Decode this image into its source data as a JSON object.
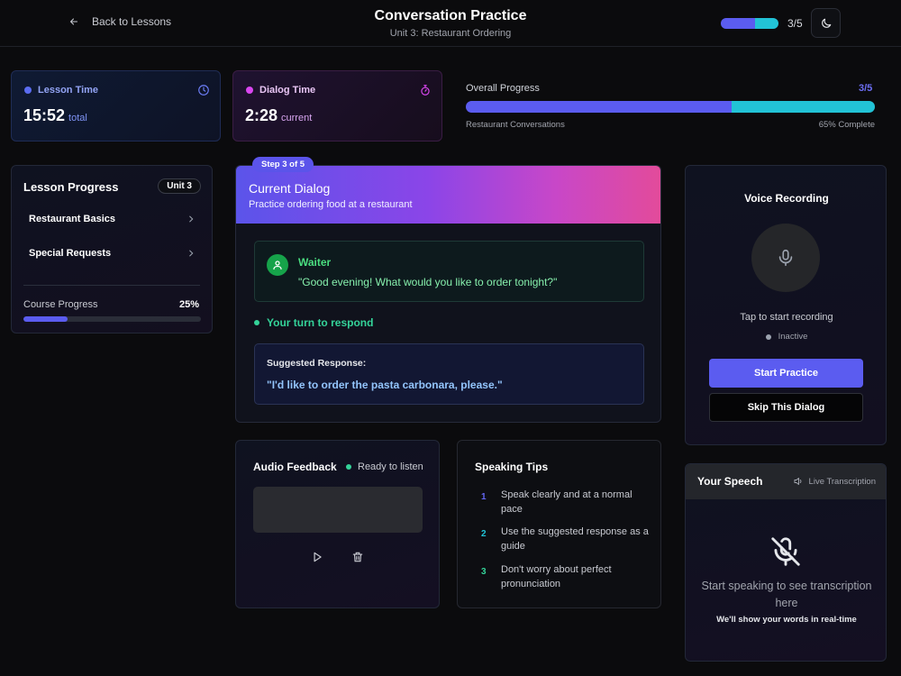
{
  "header": {
    "back_label": "Back to Lessons",
    "title": "Conversation Practice",
    "subtitle": "Unit 3: Restaurant Ordering",
    "progress_count": "3/5",
    "progress_fraction": 0.6
  },
  "stats": {
    "lesson_time": {
      "label": "Lesson Time",
      "value": "15:52",
      "unit": "total",
      "color": "#5b6cf0"
    },
    "dialog_time": {
      "label": "Dialog Time",
      "value": "2:28",
      "unit": "current",
      "color": "#d946ef"
    }
  },
  "overall": {
    "label": "Overall Progress",
    "count": "3/5",
    "left_caption": "Restaurant Conversations",
    "right_caption": "65% Complete",
    "fraction": 0.65
  },
  "lesson_progress": {
    "title": "Lesson Progress",
    "badge": "Unit 3",
    "items": [
      {
        "label": "Restaurant Basics"
      },
      {
        "label": "Special Requests"
      }
    ],
    "course_label": "Course Progress",
    "course_value": "25%",
    "course_fraction": 0.25
  },
  "dialog": {
    "step_badge": "Step 3 of 5",
    "title": "Current Dialog",
    "subtitle": "Practice ordering food at a restaurant",
    "speaker": "Waiter",
    "line": "\"Good evening! What would you like to order tonight?\"",
    "turn_label": "Your turn to respond",
    "suggested_label": "Suggested Response:",
    "suggested_text": "\"I'd like to order the pasta carbonara, please.\""
  },
  "audio_feedback": {
    "title": "Audio Feedback",
    "status": "Ready to listen"
  },
  "tips": {
    "title": "Speaking Tips",
    "items": [
      {
        "num": "1",
        "text": "Speak clearly and at a normal pace",
        "color": "#6366f1"
      },
      {
        "num": "2",
        "text": "Use the suggested response as a guide",
        "color": "#22c3d6"
      },
      {
        "num": "3",
        "text": "Don't worry about perfect pronunciation",
        "color": "#34d399"
      }
    ]
  },
  "voice": {
    "title": "Voice Recording",
    "tap_label": "Tap to start recording",
    "state": "Inactive",
    "start_label": "Start Practice",
    "skip_label": "Skip This Dialog"
  },
  "speech": {
    "title": "Your Speech",
    "live_label": "Live Transcription",
    "hint": "Start speaking to see transcription here",
    "hint_sub": "We'll show your words in real-time"
  },
  "colors": {
    "accent": "#5b5cf0",
    "secondary": "#22c3d6",
    "success": "#34d399"
  }
}
